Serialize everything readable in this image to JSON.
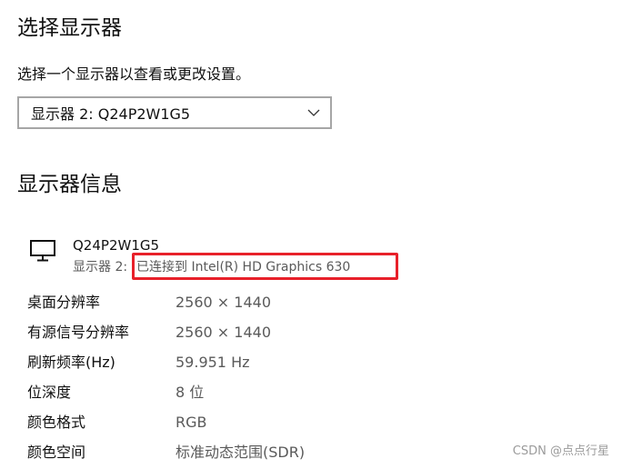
{
  "page": {
    "title": "选择显示器",
    "subtitle": "选择一个显示器以查看或更改设置。"
  },
  "display_select": {
    "selected": "显示器 2: Q24P2W1G5"
  },
  "section": {
    "title": "显示器信息"
  },
  "monitor": {
    "icon": "monitor-icon",
    "name": "Q24P2W1G5",
    "sub_prefix": "显示器 2:",
    "connection": "已连接到 Intel(R) HD Graphics 630"
  },
  "properties": [
    {
      "label": "桌面分辨率",
      "value": "2560 × 1440"
    },
    {
      "label": "有源信号分辨率",
      "value": "2560 × 1440"
    },
    {
      "label": "刷新频率(Hz)",
      "value": "59.951 Hz"
    },
    {
      "label": "位深度",
      "value": "8 位"
    },
    {
      "label": "颜色格式",
      "value": "RGB"
    },
    {
      "label": "颜色空间",
      "value": "标准动态范围(SDR)"
    }
  ],
  "watermark": "CSDN @点点行星",
  "colors": {
    "highlight": "#e8202a",
    "secondary_text": "#5a5a5a",
    "dropdown_border": "#a6a6a6"
  }
}
